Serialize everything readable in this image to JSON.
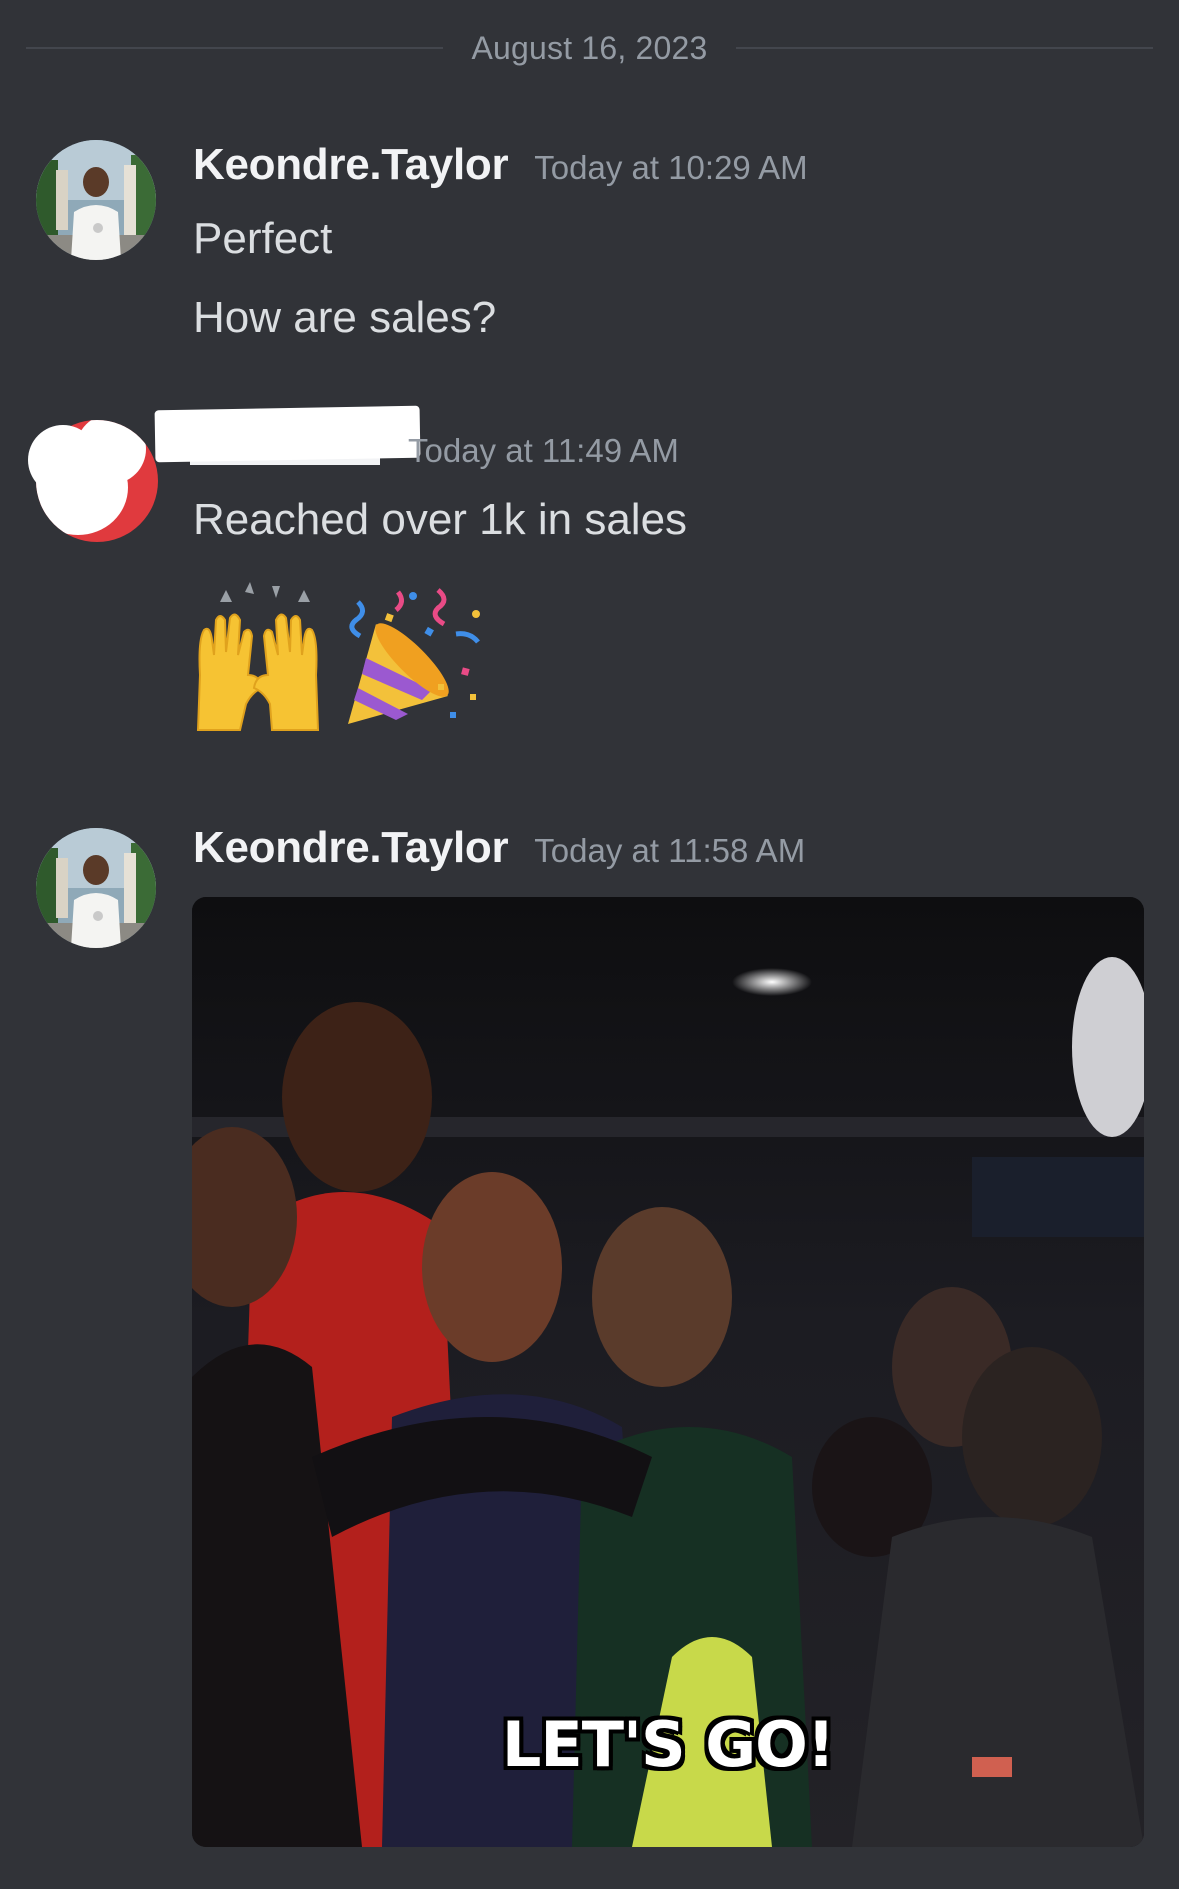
{
  "date_divider": "August 16, 2023",
  "messages": [
    {
      "username": "Keondre.Taylor",
      "timestamp": "Today at 10:29 AM",
      "lines": [
        "Perfect",
        "How are sales?"
      ]
    },
    {
      "username": "",
      "timestamp": "Today at 11:49 AM",
      "lines": [
        "Reached over 1k in sales"
      ],
      "emojis": [
        "raising-hands-emoji",
        "party-popper-emoji"
      ]
    },
    {
      "username": "Keondre.Taylor",
      "timestamp": "Today at 11:58 AM",
      "gif_caption": "LET'S GO!"
    }
  ],
  "colors": {
    "background": "#313338",
    "username": "#f2f3f5",
    "timestamp": "#949ba4",
    "text": "#dbdee1"
  }
}
